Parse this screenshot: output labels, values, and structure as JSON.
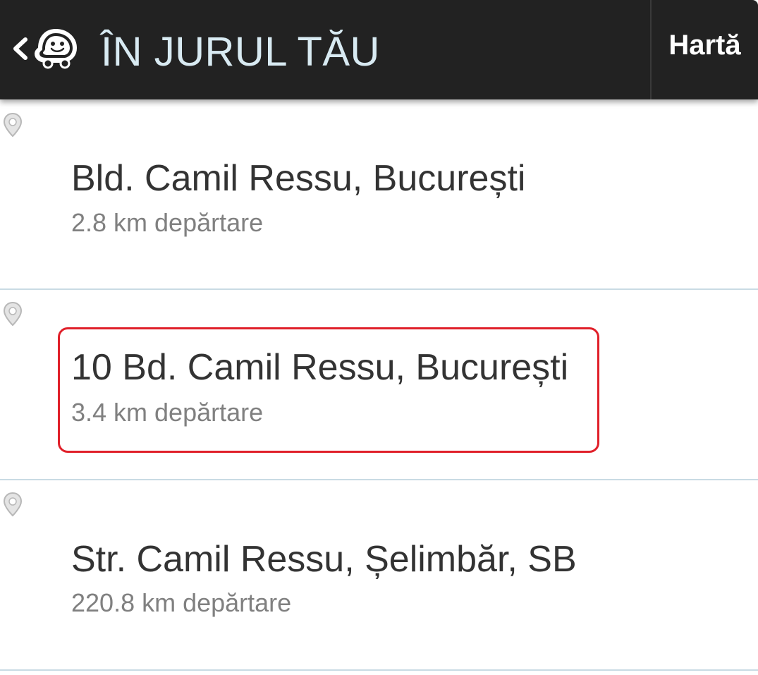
{
  "header": {
    "title": "ÎN JURUL TĂU",
    "map_button_label": "Hartă",
    "back_icon": "chevron-left-icon",
    "logo_icon": "waze-logo-icon"
  },
  "results": [
    {
      "name": "Bld. Camil Ressu, București",
      "distance": "2.8 km depărtare",
      "highlighted": false
    },
    {
      "name": "10 Bd. Camil Ressu, București",
      "distance": "3.4 km depărtare",
      "highlighted": true
    },
    {
      "name": "Str. Camil Ressu, Șelimbăr, SB",
      "distance": "220.8 km depărtare",
      "highlighted": false
    }
  ],
  "colors": {
    "header_bg": "#222222",
    "title_color": "#d8eaf2",
    "highlight_border": "#e0202a",
    "divider": "#c9dbe4"
  }
}
